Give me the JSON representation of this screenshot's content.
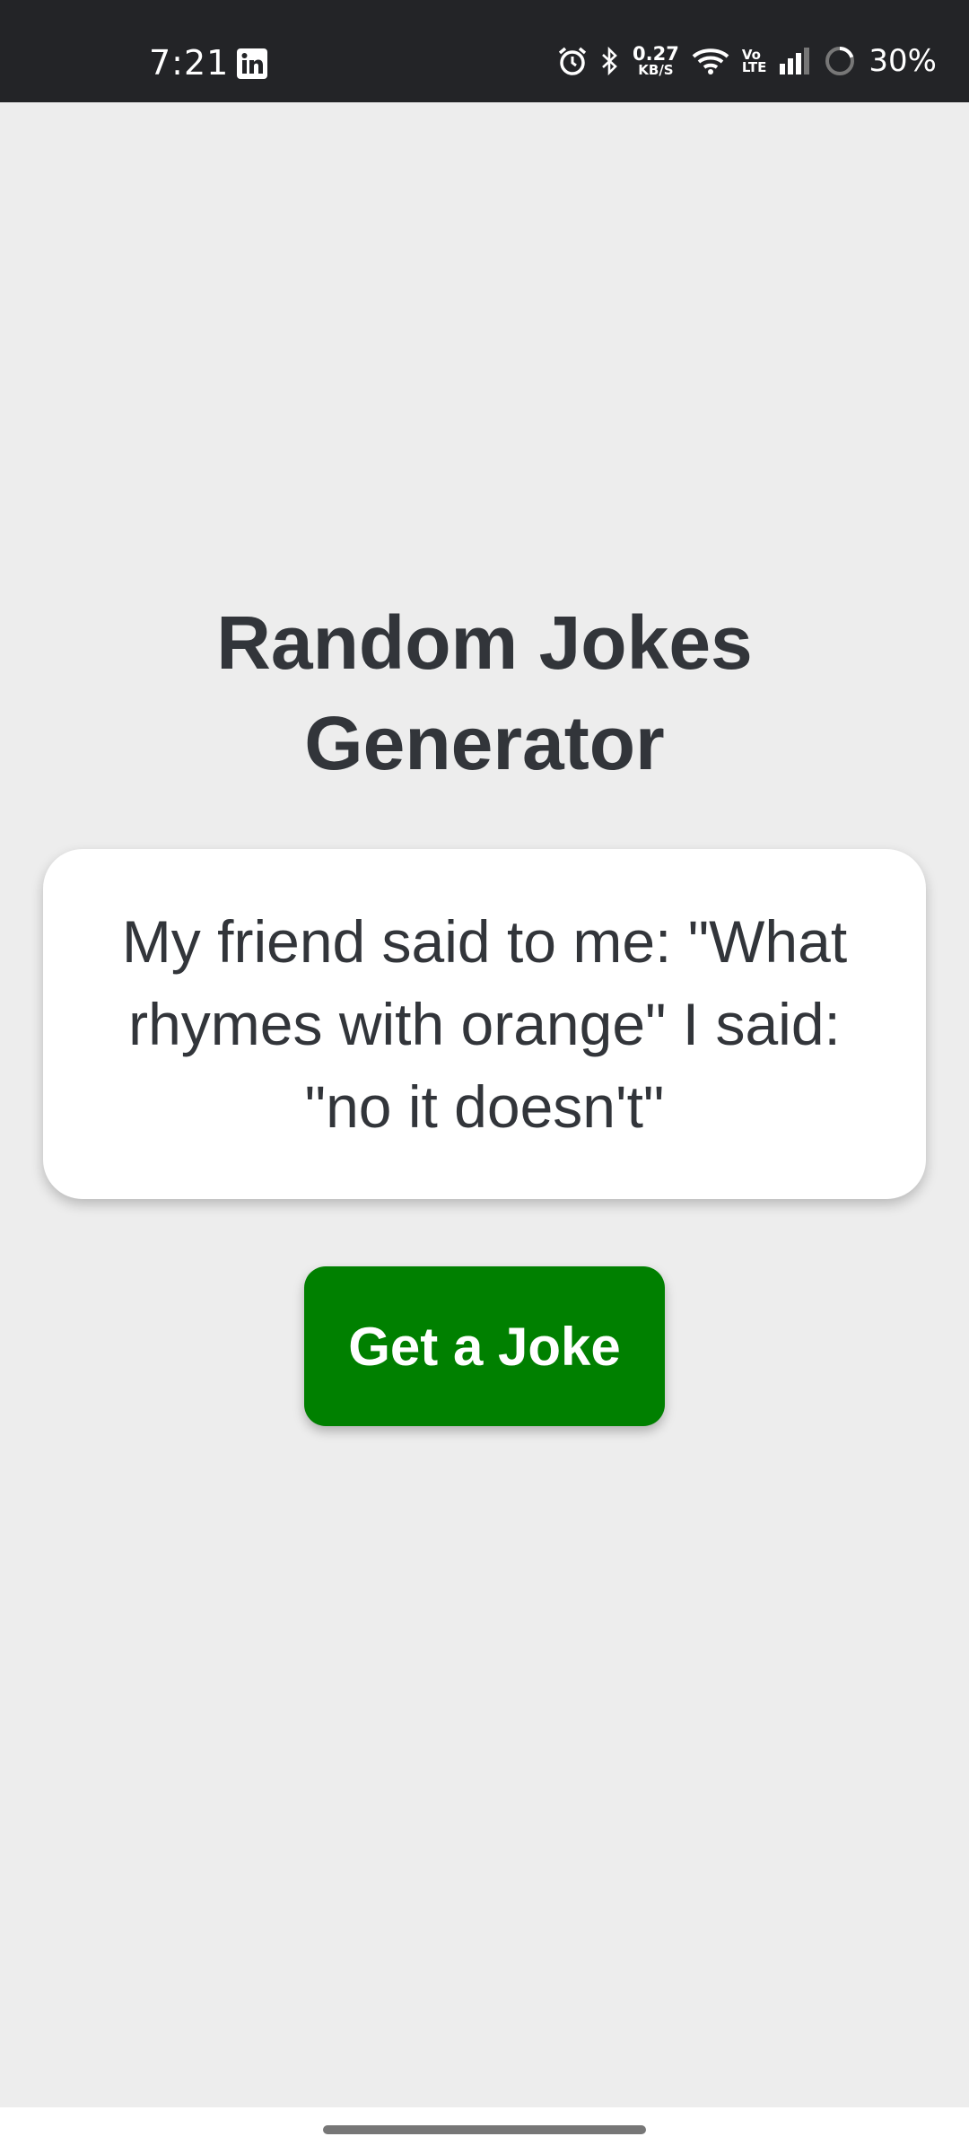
{
  "status_bar": {
    "time": "7:21",
    "notification_icon": "linkedin-icon",
    "net_speed_value": "0.27",
    "net_speed_unit": "KB/S",
    "volte_top": "Vo",
    "volte_bottom": "LTE",
    "battery": "30%",
    "icons": [
      "alarm-icon",
      "bluetooth-icon",
      "wifi-icon",
      "signal-icon",
      "battery-ring-icon"
    ]
  },
  "app": {
    "title": "Random Jokes Generator",
    "joke": "My friend said to me: \"What rhymes with orange\" I said: \"no it doesn't\"",
    "button_label": "Get a Joke"
  },
  "colors": {
    "background": "#ededed",
    "status_bar": "#232427",
    "button": "#008000",
    "text": "#32353a",
    "card": "#ffffff"
  }
}
